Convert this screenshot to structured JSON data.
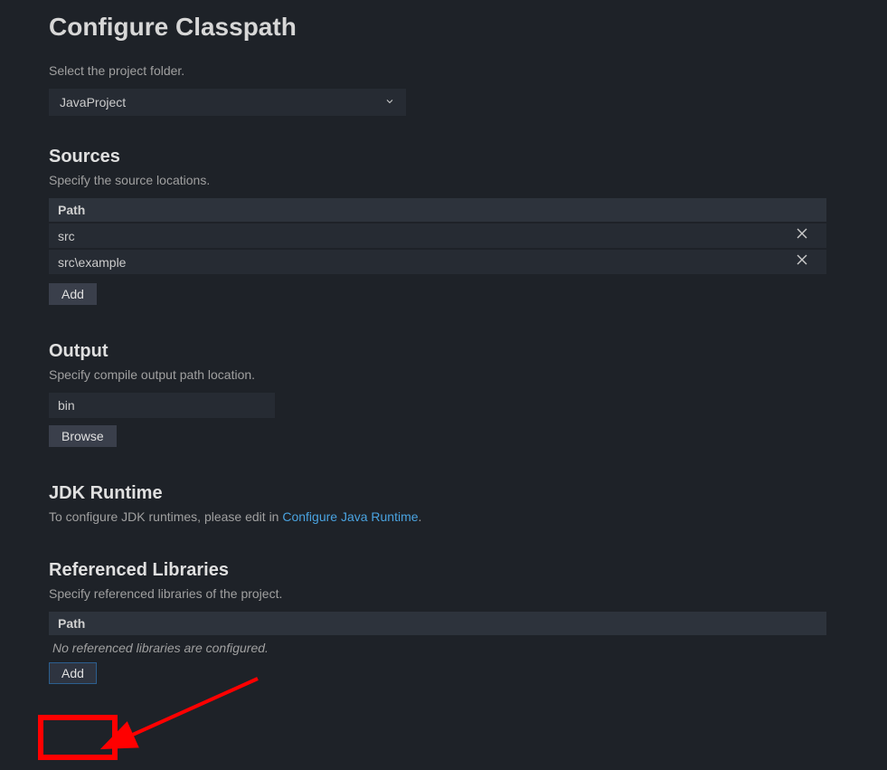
{
  "page_title": "Configure Classpath",
  "project_select": {
    "label": "Select the project folder.",
    "value": "JavaProject"
  },
  "sources": {
    "title": "Sources",
    "desc": "Specify the source locations.",
    "col_header": "Path",
    "rows": [
      "src",
      "src\\example"
    ],
    "add_label": "Add"
  },
  "output": {
    "title": "Output",
    "desc": "Specify compile output path location.",
    "value": "bin",
    "browse_label": "Browse"
  },
  "jdk": {
    "title": "JDK Runtime",
    "desc_prefix": "To configure JDK runtimes, please edit in ",
    "link_text": "Configure Java Runtime",
    "desc_suffix": "."
  },
  "libs": {
    "title": "Referenced Libraries",
    "desc": "Specify referenced libraries of the project.",
    "col_header": "Path",
    "empty_msg": "No referenced libraries are configured.",
    "add_label": "Add"
  }
}
